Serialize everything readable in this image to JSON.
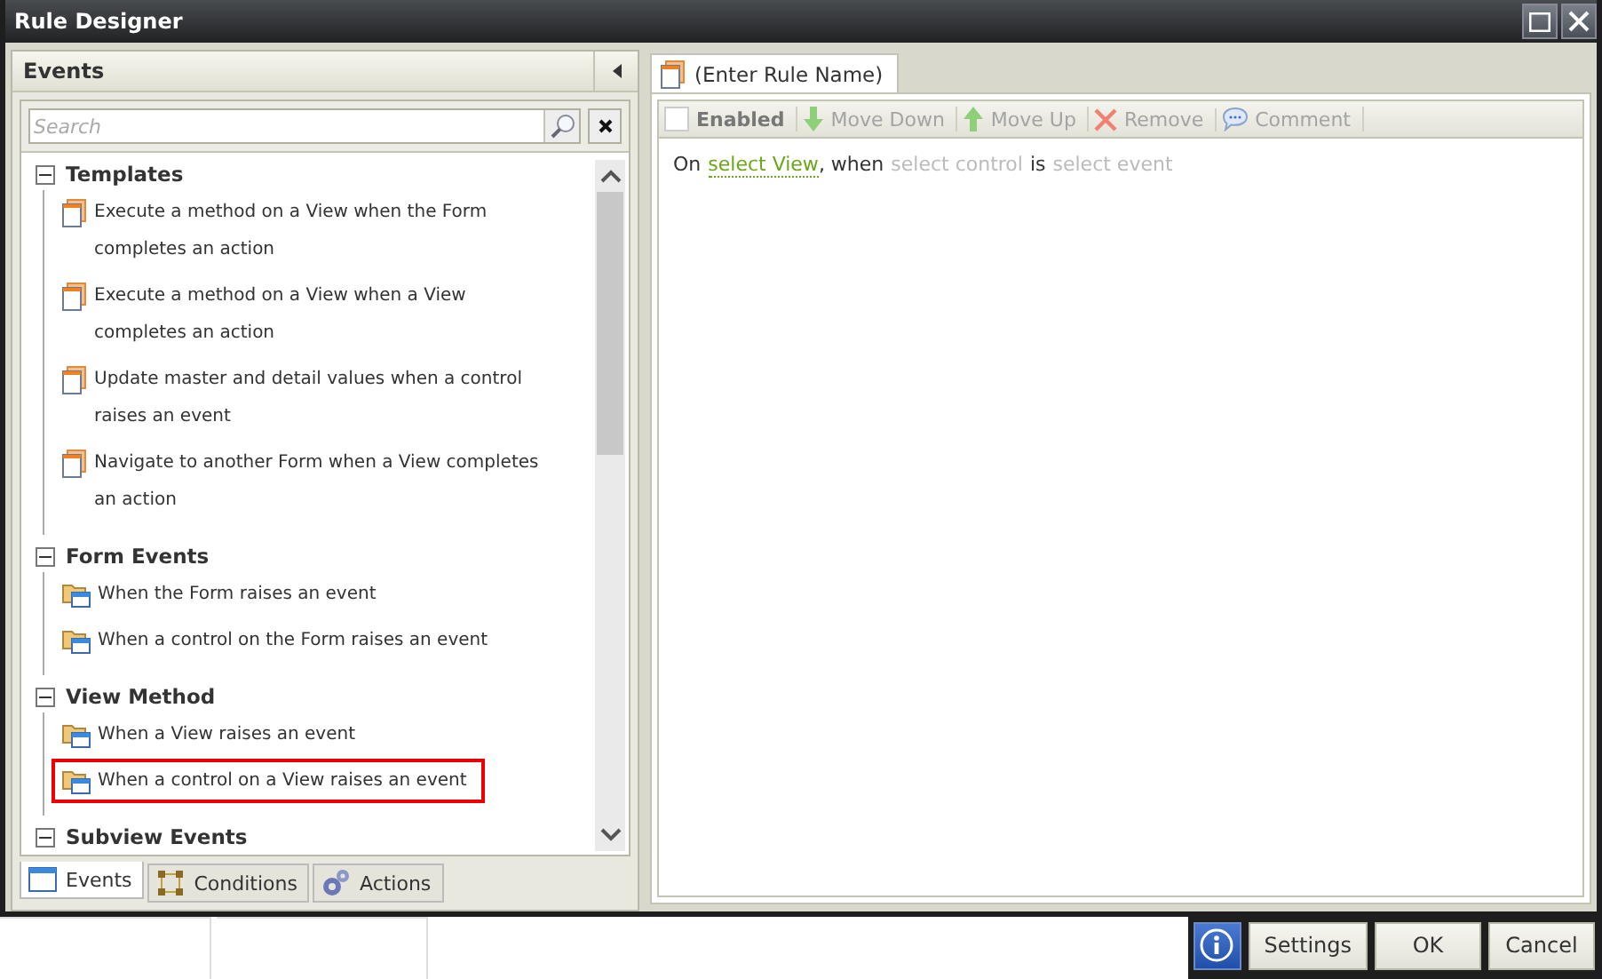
{
  "window": {
    "title": "Rule Designer"
  },
  "events_panel": {
    "title": "Events",
    "search": {
      "placeholder": "Search"
    },
    "groups": [
      {
        "label": "Templates",
        "expanded": true,
        "kind": "template",
        "items": [
          {
            "label": "Execute a method on a View when the Form completes an action",
            "highlighted": false
          },
          {
            "label": "Execute a method on a View when a View completes an action",
            "highlighted": false
          },
          {
            "label": "Update master and detail values when a control raises an event",
            "highlighted": false
          },
          {
            "label": "Navigate to another Form when a View completes an action",
            "highlighted": false
          }
        ]
      },
      {
        "label": "Form Events",
        "expanded": true,
        "kind": "event",
        "items": [
          {
            "label": "When the Form raises an event",
            "highlighted": false
          },
          {
            "label": "When a control on the Form raises an event",
            "highlighted": false
          }
        ]
      },
      {
        "label": "View Method",
        "expanded": true,
        "kind": "event",
        "items": [
          {
            "label": "When a View raises an event",
            "highlighted": false
          },
          {
            "label": "When a control on a View raises an event",
            "highlighted": true
          }
        ]
      },
      {
        "label": "Subview Events",
        "expanded": true,
        "kind": "event"
      }
    ],
    "tabs": [
      {
        "label": "Events",
        "kind": "events",
        "selected": true
      },
      {
        "label": "Conditions",
        "kind": "conditions",
        "selected": false
      },
      {
        "label": "Actions",
        "kind": "actions",
        "selected": false
      }
    ]
  },
  "rule_panel": {
    "tab": {
      "label": "(Enter Rule Name)"
    },
    "toolbar": [
      {
        "label": "Enabled",
        "kind": "checkbox",
        "checked": false,
        "disabled": false
      },
      {
        "label": "Move Down",
        "kind": "down",
        "disabled": true
      },
      {
        "label": "Move Up",
        "kind": "up",
        "disabled": true
      },
      {
        "label": "Remove",
        "kind": "remove",
        "disabled": true
      },
      {
        "label": "Comment",
        "kind": "comment",
        "disabled": true
      }
    ],
    "sentence": [
      {
        "text": "On",
        "kind": "plain"
      },
      {
        "text": "select View",
        "kind": "link"
      },
      {
        "text": ", when",
        "kind": "plain"
      },
      {
        "text": "select control",
        "kind": "placeholder"
      },
      {
        "text": "is",
        "kind": "plain"
      },
      {
        "text": "select event",
        "kind": "placeholder"
      }
    ]
  },
  "buttons": [
    {
      "label": "Settings"
    },
    {
      "label": "OK"
    },
    {
      "label": "Cancel"
    }
  ]
}
